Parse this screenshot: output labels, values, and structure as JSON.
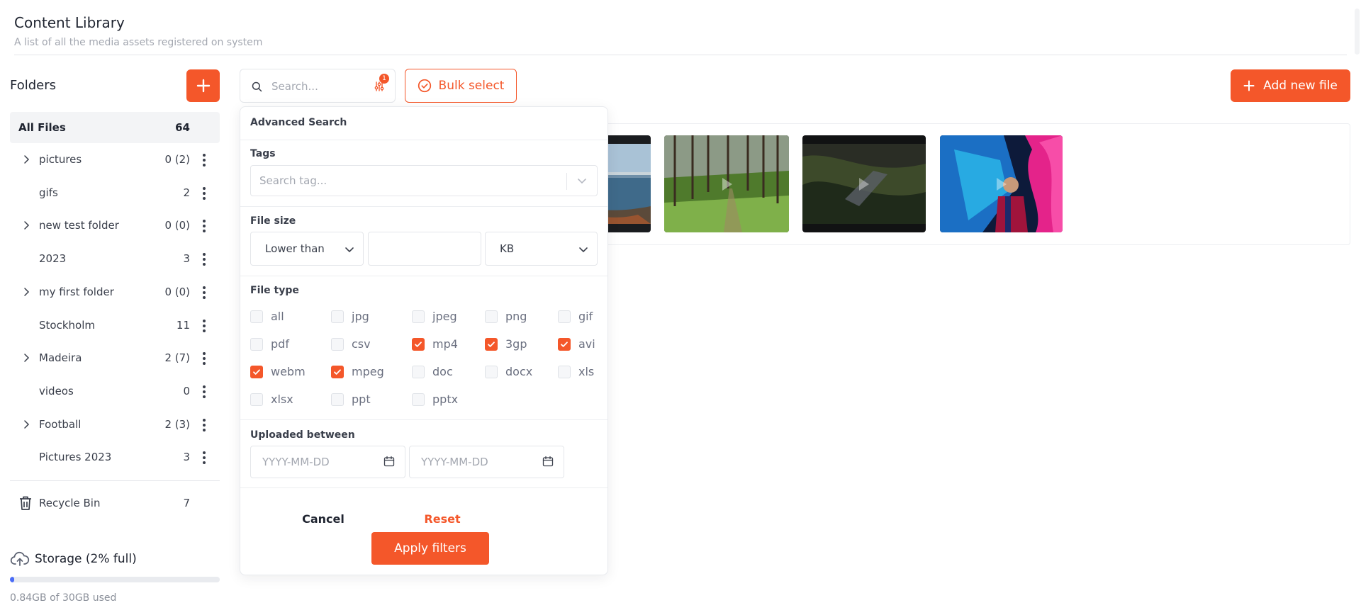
{
  "header": {
    "title": "Content Library",
    "subtitle": "A list of all the media assets registered on system"
  },
  "sidebar": {
    "title": "Folders",
    "all_files": {
      "label": "All Files",
      "count": "64"
    },
    "folders": [
      {
        "name": "pictures",
        "count": "0 (2)",
        "expandable": true
      },
      {
        "name": "gifs",
        "count": "2",
        "expandable": false
      },
      {
        "name": "new test folder",
        "count": "0 (0)",
        "expandable": true
      },
      {
        "name": "2023",
        "count": "3",
        "expandable": false
      },
      {
        "name": "my first folder",
        "count": "0 (0)",
        "expandable": true
      },
      {
        "name": "Stockholm",
        "count": "11",
        "expandable": false
      },
      {
        "name": "Madeira",
        "count": "2 (7)",
        "expandable": true
      },
      {
        "name": "videos",
        "count": "0",
        "expandable": false
      },
      {
        "name": "Football",
        "count": "2 (3)",
        "expandable": true
      },
      {
        "name": "Pictures 2023",
        "count": "3",
        "expandable": false
      }
    ],
    "recycle_bin": {
      "label": "Recycle Bin",
      "count": "7"
    },
    "storage": {
      "title": "Storage (2% full)",
      "used_text": "0.84GB of 30GB used",
      "percent": 2
    }
  },
  "toolbar": {
    "search_placeholder": "Search...",
    "filter_badge": "1",
    "bulk_select_label": "Bulk select",
    "add_file_label": "Add new file"
  },
  "advanced_search": {
    "title": "Advanced Search",
    "tags": {
      "label": "Tags",
      "placeholder": "Search tag..."
    },
    "file_size": {
      "label": "File size",
      "comparator": "Lower than",
      "value": "",
      "unit": "KB"
    },
    "file_type": {
      "label": "File type",
      "options": [
        {
          "label": "all",
          "checked": false
        },
        {
          "label": "jpg",
          "checked": false
        },
        {
          "label": "jpeg",
          "checked": false
        },
        {
          "label": "png",
          "checked": false
        },
        {
          "label": "gif",
          "checked": false
        },
        {
          "label": "pdf",
          "checked": false
        },
        {
          "label": "csv",
          "checked": false
        },
        {
          "label": "mp4",
          "checked": true
        },
        {
          "label": "3gp",
          "checked": true
        },
        {
          "label": "avi",
          "checked": true
        },
        {
          "label": "webm",
          "checked": true
        },
        {
          "label": "mpeg",
          "checked": true
        },
        {
          "label": "doc",
          "checked": false
        },
        {
          "label": "docx",
          "checked": false
        },
        {
          "label": "xls",
          "checked": false
        },
        {
          "label": "xlsx",
          "checked": false
        },
        {
          "label": "ppt",
          "checked": false
        },
        {
          "label": "pptx",
          "checked": false
        }
      ]
    },
    "uploaded_between": {
      "label": "Uploaded between",
      "from_placeholder": "YYYY-MM-DD",
      "to_placeholder": "YYYY-MM-DD"
    },
    "cancel_label": "Cancel",
    "reset_label": "Reset",
    "apply_label": "Apply filters"
  },
  "colors": {
    "accent": "#f4572a",
    "storage_fill": "#4a6cf7"
  }
}
